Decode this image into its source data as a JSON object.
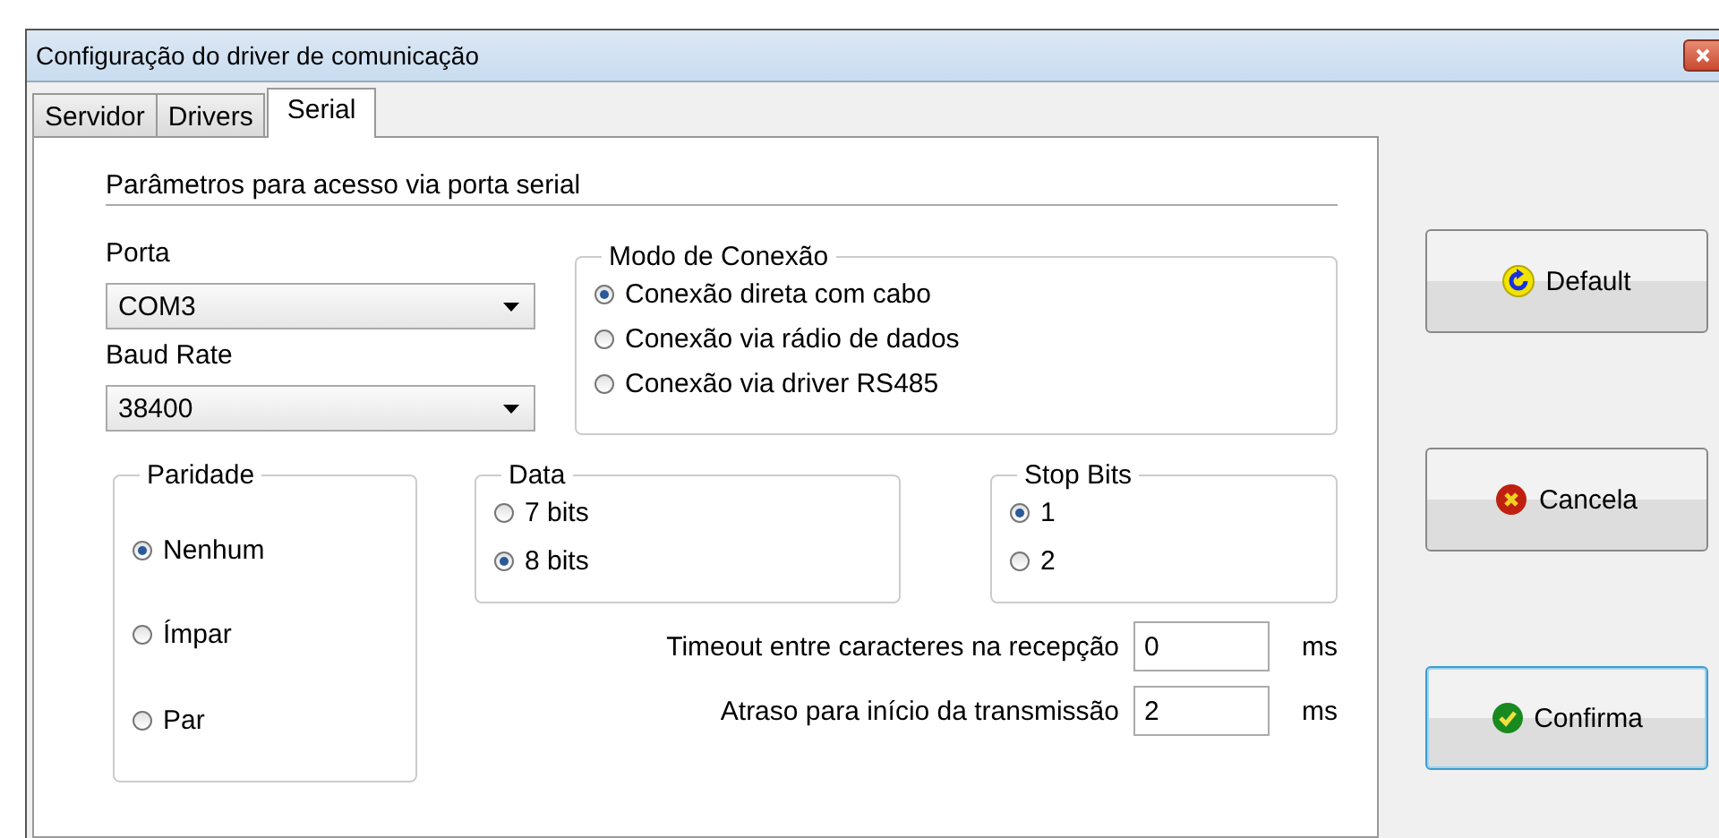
{
  "window": {
    "title": "Configuração do driver de comunicação"
  },
  "tabs": [
    {
      "label": "Servidor",
      "selected": false
    },
    {
      "label": "Drivers",
      "selected": false
    },
    {
      "label": "Serial",
      "selected": true
    }
  ],
  "section_title": "Parâmetros para acesso via porta serial",
  "port": {
    "label": "Porta",
    "value": "COM3"
  },
  "baud_rate": {
    "label": "Baud Rate",
    "value": "38400"
  },
  "connection_mode": {
    "title": "Modo de Conexão",
    "options": [
      {
        "label": "Conexão direta com cabo",
        "selected": true
      },
      {
        "label": "Conexão via rádio de dados",
        "selected": false
      },
      {
        "label": "Conexão via driver RS485",
        "selected": false
      }
    ]
  },
  "parity": {
    "title": "Paridade",
    "options": [
      {
        "label": "Nenhum",
        "selected": true
      },
      {
        "label": "Ímpar",
        "selected": false
      },
      {
        "label": "Par",
        "selected": false
      }
    ]
  },
  "data_bits": {
    "title": "Data",
    "options": [
      {
        "label": "7 bits",
        "selected": false
      },
      {
        "label": "8 bits",
        "selected": true
      }
    ]
  },
  "stop_bits": {
    "title": "Stop Bits",
    "options": [
      {
        "label": "1",
        "selected": true
      },
      {
        "label": "2",
        "selected": false
      }
    ]
  },
  "timing": [
    {
      "label": "Timeout entre caracteres na recepção",
      "value": "0",
      "unit": "ms"
    },
    {
      "label": "Atraso para início da transmissão",
      "value": "2",
      "unit": "ms"
    }
  ],
  "buttons": [
    {
      "label": "Default",
      "kind": "default",
      "focused": false
    },
    {
      "label": "Cancela",
      "kind": "cancel",
      "focused": false
    },
    {
      "label": "Confirma",
      "kind": "confirm",
      "focused": true
    }
  ]
}
